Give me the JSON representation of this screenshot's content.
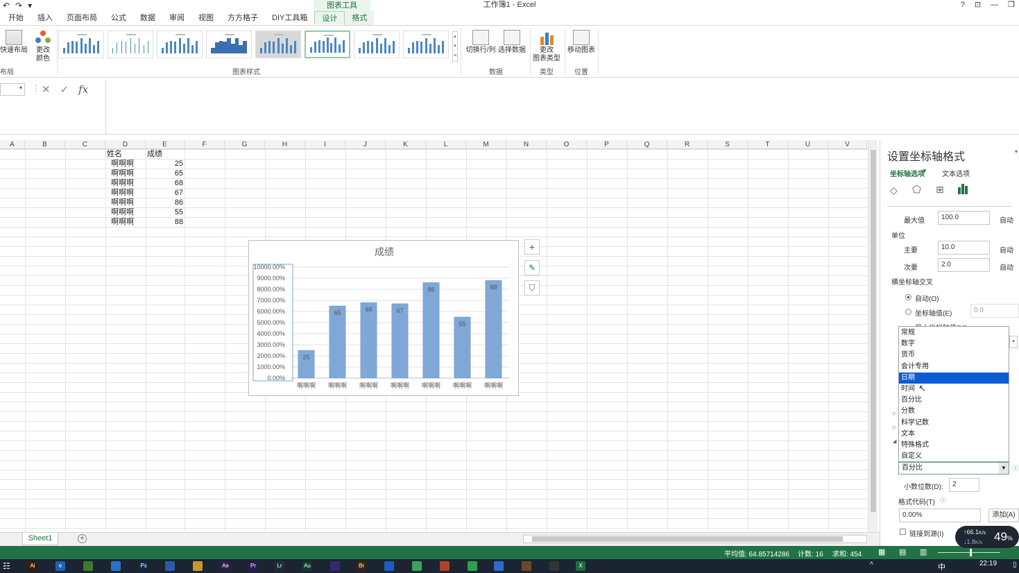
{
  "window": {
    "title": "工作簿1 - Excel",
    "context_tool": "图表工具",
    "controls": [
      "?",
      "⊡",
      "—",
      "❐"
    ]
  },
  "qat": [
    "↶",
    "↷",
    "▾"
  ],
  "tabs": [
    "开始",
    "插入",
    "页面布局",
    "公式",
    "数据",
    "审阅",
    "视图",
    "方方格子",
    "DIY工具箱",
    "设计",
    "格式"
  ],
  "ribbon": {
    "quick_layout": "快速布局",
    "change_colors_1": "更改",
    "change_colors_2": "颜色",
    "layout_group": "布局",
    "styles_group": "图表样式",
    "switch_row_col": "切换行/列",
    "select_data": "选择数据",
    "data_group": "数据",
    "change_type_1": "更改",
    "change_type_2": "图表类型",
    "type_group": "类型",
    "move_chart": "移动图表",
    "location_group": "位置"
  },
  "formula": {
    "fx": "fx",
    "cancel": "✕",
    "enter": "✓"
  },
  "columns": [
    "A",
    "B",
    "C",
    "D",
    "E",
    "F",
    "G",
    "H",
    "I",
    "J",
    "K",
    "L",
    "M",
    "N",
    "O",
    "P",
    "Q",
    "R",
    "S",
    "T",
    "U",
    "V"
  ],
  "table": {
    "header_name": "姓名",
    "header_score": "成绩",
    "rows": [
      {
        "name": "啊啊啊",
        "score": "25"
      },
      {
        "name": "啊啊啊",
        "score": "65"
      },
      {
        "name": "啊啊啊",
        "score": "68"
      },
      {
        "name": "啊啊啊",
        "score": "67"
      },
      {
        "name": "啊啊啊",
        "score": "86"
      },
      {
        "name": "啊啊啊",
        "score": "55"
      },
      {
        "name": "啊啊啊",
        "score": "88"
      }
    ]
  },
  "chart_data": {
    "type": "bar",
    "title": "成绩",
    "categories": [
      "啊啊啊",
      "啊啊啊",
      "啊啊啊",
      "啊啊啊",
      "啊啊啊",
      "啊啊啊",
      "啊啊啊"
    ],
    "values": [
      25,
      65,
      68,
      67,
      86,
      55,
      88
    ],
    "ylim": [
      0,
      100
    ],
    "yticks": [
      "0.00%",
      "1000.00%",
      "2000.00%",
      "3000.00%",
      "4000.00%",
      "5000.00%",
      "6000.00%",
      "7000.00%",
      "8000.00%",
      "9000.00%",
      "10000.00%"
    ],
    "grid": true,
    "bar_color": "#7fa8d8"
  },
  "panel": {
    "title": "设置坐标轴格式",
    "tab_axis": "坐标轴选项",
    "tab_text": "文本选项",
    "max_label": "最大值",
    "max_value": "100.0",
    "auto": "自动",
    "unit_label": "单位",
    "major_label": "主要",
    "major_value": "10.0",
    "minor_label": "次要",
    "minor_value": "2.0",
    "cross_label": "横坐标轴交叉",
    "radio_auto": "自动(O)",
    "radio_axis_value": "坐标轴值(E)",
    "axis_value": "0.0",
    "radio_max": "最大坐标轴值(M)",
    "decimal_label": "小数位数(D):",
    "decimal_value": "2",
    "format_code_label": "格式代码(T)",
    "format_code_value": "0.00%",
    "add_button": "添加(A)",
    "link_source": "链接到源(I)"
  },
  "category_dropdown": {
    "items": [
      "常规",
      "数字",
      "货币",
      "会计专用",
      "日期",
      "时间",
      "百分比",
      "分数",
      "科学记数",
      "文本",
      "特殊格式",
      "自定义"
    ],
    "selected_index": 4,
    "value": "百分比"
  },
  "sheet": {
    "tab": "Sheet1",
    "add": "+"
  },
  "status": {
    "average": "平均值: 64.85714286",
    "count": "计数: 16",
    "sum": "求和: 454"
  },
  "net_speed": {
    "up": "66.1",
    "down": "1.8",
    "unit": "K/s",
    "percent": "49",
    "pct_sign": "%"
  },
  "taskbar": {
    "time": "22:19",
    "ime": "中",
    "apps": [
      "Ai",
      "e",
      "",
      "",
      "Ps",
      "",
      "",
      "Ae",
      "Pr",
      "Lr",
      "Au",
      "",
      "Br",
      "",
      "",
      "",
      "",
      "",
      "",
      "",
      "",
      "X"
    ]
  }
}
